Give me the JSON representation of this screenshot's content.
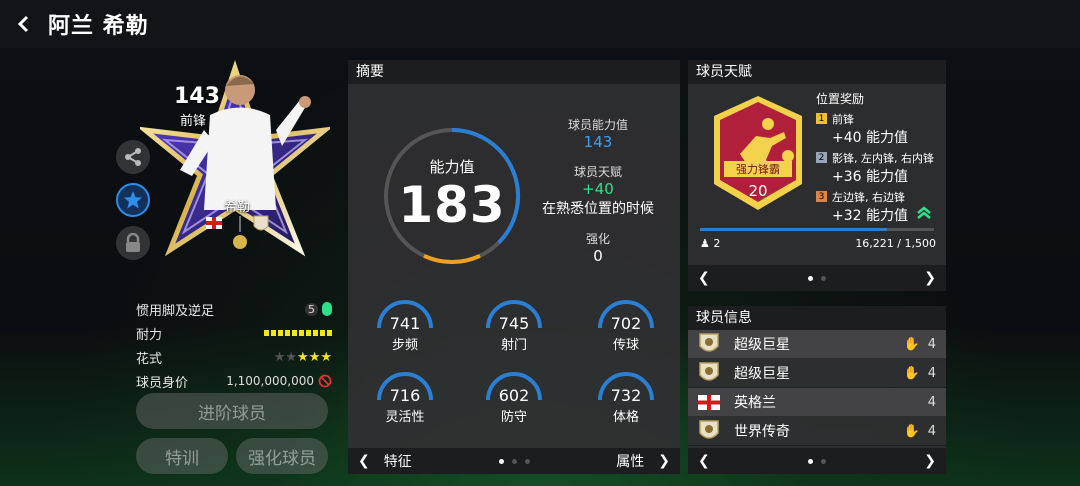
{
  "header": {
    "title": "阿兰 希勒"
  },
  "card": {
    "rating": "143",
    "position": "前锋",
    "name": "希勒"
  },
  "player_attrs": {
    "foot_label": "惯用脚及逆足",
    "foot_value": "5",
    "stamina_label": "耐力",
    "stamina_level": 1.0,
    "skill_label": "花式",
    "skill_stars": 3,
    "skill_stars_max": 5,
    "value_label": "球员身价",
    "value": "1,100,000,000"
  },
  "buttons": {
    "advance": "进阶球员",
    "train": "特训",
    "enhance": "强化球员"
  },
  "summary": {
    "title": "摘要",
    "ovr_label": "能力值",
    "ovr_value": "183",
    "ability_label": "球员能力值",
    "ability_value": "143",
    "talent_label": "球员天赋",
    "talent_value": "+40",
    "talent_desc": "在熟悉位置的时候",
    "enhance_label": "强化",
    "enhance_value": "0",
    "stats": [
      {
        "value": "741",
        "label": "步频"
      },
      {
        "value": "745",
        "label": "射门"
      },
      {
        "value": "702",
        "label": "传球"
      },
      {
        "value": "716",
        "label": "灵活性"
      },
      {
        "value": "602",
        "label": "防守"
      },
      {
        "value": "732",
        "label": "体格"
      }
    ],
    "footer_left": "特征",
    "footer_right": "属性"
  },
  "talent": {
    "title": "球员天赋",
    "badge_name": "强力锋霸",
    "badge_level": "20",
    "bonus_head": "位置奖励",
    "bonuses": [
      {
        "num": "1",
        "pos": "前锋",
        "bonus": "+40 能力值",
        "color": "#f0c030"
      },
      {
        "num": "2",
        "pos": "影锋, 左内锋, 右内锋",
        "bonus": "+36 能力值",
        "color": "#9aa6b8"
      },
      {
        "num": "3",
        "pos": "左边锋, 右边锋",
        "bonus": "+32 能力值",
        "color": "#d8864a"
      }
    ],
    "count": "2",
    "progress_text": "16,221 / 1,500",
    "progress_fill": 0.8
  },
  "player_info": {
    "title": "球员信息",
    "rows": [
      {
        "name": "超级巨星",
        "icon": "badge-icon",
        "count": "4"
      },
      {
        "name": "超级巨星",
        "icon": "badge-icon",
        "count": "4"
      },
      {
        "name": "英格兰",
        "icon": "england-flag-icon",
        "count": "4"
      },
      {
        "name": "世界传奇",
        "icon": "badge-icon",
        "count": "4"
      }
    ]
  },
  "colors": {
    "blue": "#2a7fd4",
    "green": "#2ee08a",
    "orange": "#f0a020",
    "gold": "#f0c030"
  }
}
